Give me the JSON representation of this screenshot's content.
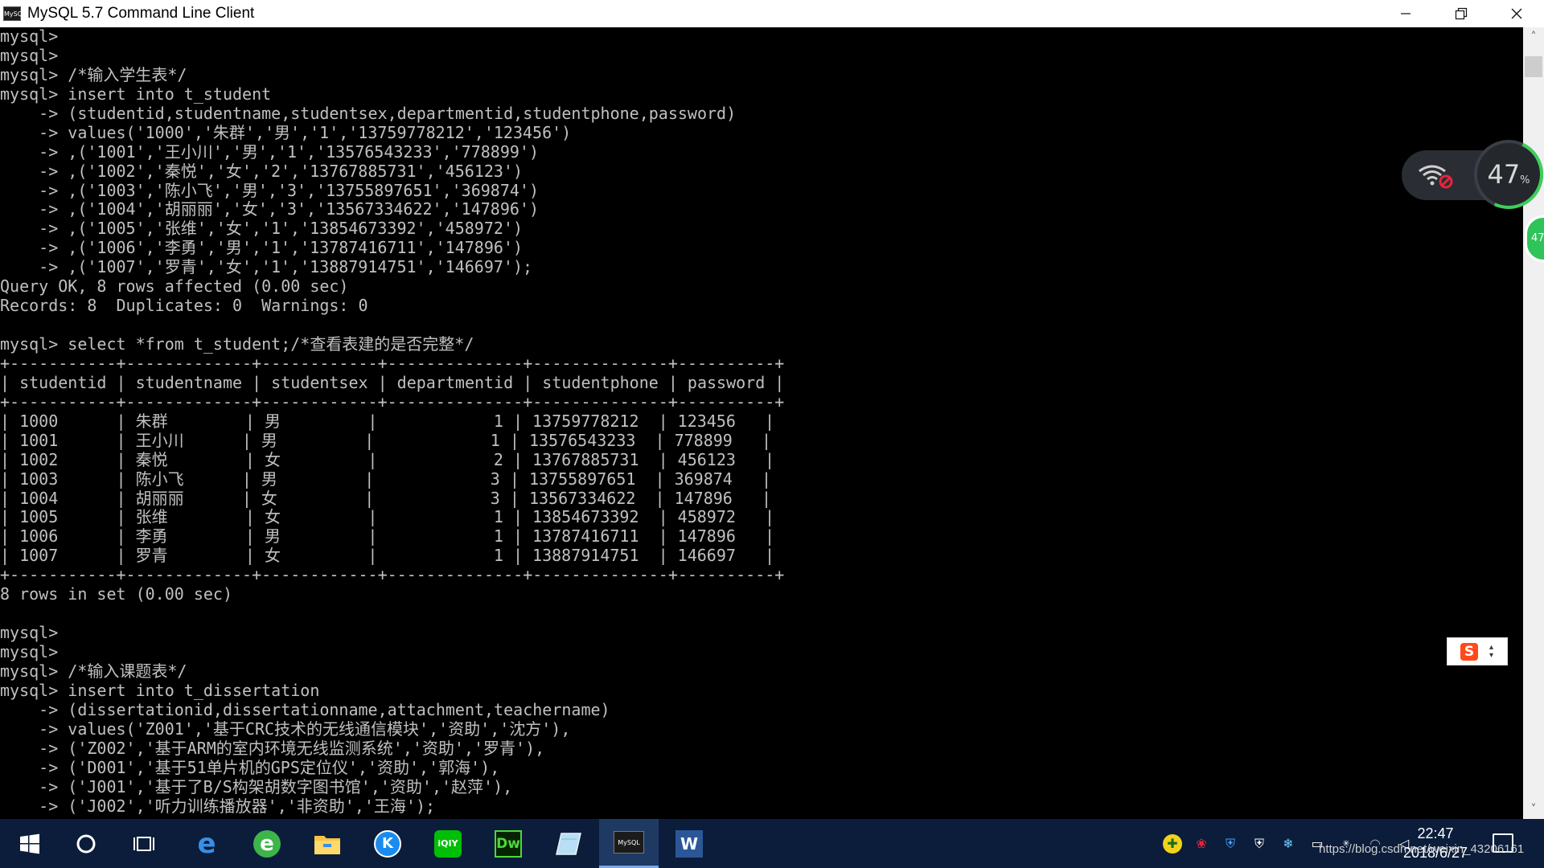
{
  "window": {
    "title": "MySQL 5.7 Command Line Client",
    "icon_label": "MySQL",
    "controls": [
      "minimize-icon",
      "restore-icon",
      "close-icon"
    ]
  },
  "console": {
    "lines": [
      "mysql>",
      "mysql>",
      "mysql> /*输入学生表*/",
      "mysql> insert into t_student",
      "    -> (studentid,studentname,studentsex,departmentid,studentphone,password)",
      "    -> values('1000','朱群','男','1','13759778212','123456')",
      "    -> ,('1001','王小川','男','1','13576543233','778899')",
      "    -> ,('1002','秦悦','女','2','13767885731','456123')",
      "    -> ,('1003','陈小飞','男','3','13755897651','369874')",
      "    -> ,('1004','胡丽丽','女','3','13567334622','147896')",
      "    -> ,('1005','张维','女','1','13854673392','458972')",
      "    -> ,('1006','李勇','男','1','13787416711','147896')",
      "    -> ,('1007','罗青','女','1','13887914751','146697');",
      "Query OK, 8 rows affected (0.00 sec)",
      "Records: 8  Duplicates: 0  Warnings: 0",
      "",
      "mysql> select *from t_student;/*查看表建的是否完整*/",
      "+-----------+-------------+------------+--------------+--------------+----------+",
      "| studentid | studentname | studentsex | departmentid | studentphone | password |",
      "+-----------+-------------+------------+--------------+--------------+----------+",
      "| 1000      | 朱群        | 男         |            1 | 13759778212  | 123456   |",
      "| 1001      | 王小川      | 男         |            1 | 13576543233  | 778899   |",
      "| 1002      | 秦悦        | 女         |            2 | 13767885731  | 456123   |",
      "| 1003      | 陈小飞      | 男         |            3 | 13755897651  | 369874   |",
      "| 1004      | 胡丽丽      | 女         |            3 | 13567334622  | 147896   |",
      "| 1005      | 张维        | 女         |            1 | 13854673392  | 458972   |",
      "| 1006      | 李勇        | 男         |            1 | 13787416711  | 147896   |",
      "| 1007      | 罗青        | 女         |            1 | 13887914751  | 146697   |",
      "+-----------+-------------+------------+--------------+--------------+----------+",
      "8 rows in set (0.00 sec)",
      "",
      "mysql>",
      "mysql>",
      "mysql> /*输入课题表*/",
      "mysql> insert into t_dissertation",
      "    -> (dissertationid,dissertationname,attachment,teachername)",
      "    -> values('Z001','基于CRC技术的无线通信模块','资助','沈方'),",
      "    -> ('Z002','基于ARM的室内环境无线监测系统','资助','罗青'),",
      "    -> ('D001','基于51单片机的GPS定位仪','资助','郭海'),",
      "    -> ('J001','基于了B/S构架胡数字图书馆','资助','赵萍'),",
      "    -> ('J002','听力训练播放器','非资助','王海');"
    ]
  },
  "widgets": {
    "cpu_percent": "47",
    "cpu_unit": "%",
    "green_badge": "47",
    "ime_label": "S"
  },
  "taskbar": {
    "apps": [
      {
        "name": "start-button",
        "icon": "windows-logo-icon"
      },
      {
        "name": "search-button",
        "icon": "cortana-icon"
      },
      {
        "name": "task-view-button",
        "icon": "task-view-icon"
      },
      {
        "name": "edge-button",
        "icon": "edge-icon",
        "label": "e"
      },
      {
        "name": "browser-360-button",
        "icon": "browser-360-icon",
        "label": "e"
      },
      {
        "name": "file-explorer-button",
        "icon": "folder-icon"
      },
      {
        "name": "kugou-button",
        "icon": "kugou-icon",
        "label": "K"
      },
      {
        "name": "iqiyi-button",
        "icon": "iqiyi-icon",
        "label": "iQIY"
      },
      {
        "name": "dreamweaver-button",
        "icon": "dreamweaver-icon",
        "label": "Dw"
      },
      {
        "name": "notebook-button",
        "icon": "notebook-icon"
      },
      {
        "name": "mysql-client-button",
        "icon": "mysql-icon",
        "label": "MySQL"
      },
      {
        "name": "word-button",
        "icon": "word-icon",
        "label": "W"
      }
    ],
    "clock_time": "22:47",
    "clock_date": "2018/6/27",
    "watermark": "https://blog.csdn.net/weixin_43206161"
  }
}
